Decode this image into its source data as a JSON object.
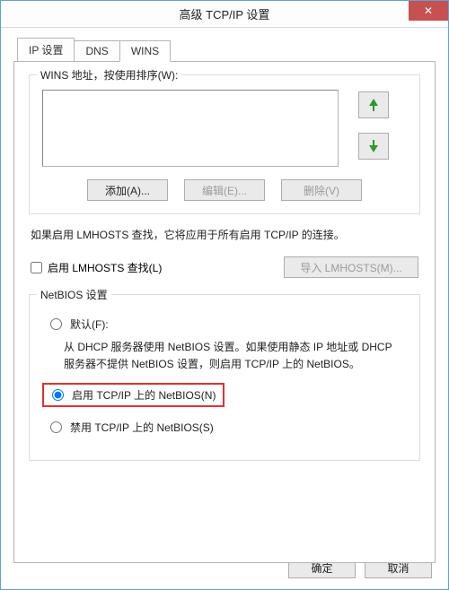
{
  "window": {
    "title": "高级 TCP/IP 设置",
    "close_label": "✕"
  },
  "tabs": {
    "ip": "IP 设置",
    "dns": "DNS",
    "wins": "WINS"
  },
  "wins_group": {
    "legend": "WINS 地址，按使用排序(W):",
    "add": "添加(A)...",
    "edit": "编辑(E)...",
    "remove": "删除(V)"
  },
  "lmhosts": {
    "info": "如果启用 LMHOSTS 查找，它将应用于所有启用 TCP/IP 的连接。",
    "enable_label": "启用 LMHOSTS 查找(L)",
    "import_label": "导入 LMHOSTS(M)..."
  },
  "netbios": {
    "legend": "NetBIOS 设置",
    "default_label": "默认(F):",
    "default_desc": "从 DHCP 服务器使用 NetBIOS 设置。如果使用静态 IP 地址或 DHCP 服务器不提供 NetBIOS 设置，则启用 TCP/IP 上的 NetBIOS。",
    "enable_label": "启用 TCP/IP 上的 NetBIOS(N)",
    "disable_label": "禁用 TCP/IP 上的 NetBIOS(S)"
  },
  "dialog": {
    "ok": "确定",
    "cancel": "取消"
  }
}
